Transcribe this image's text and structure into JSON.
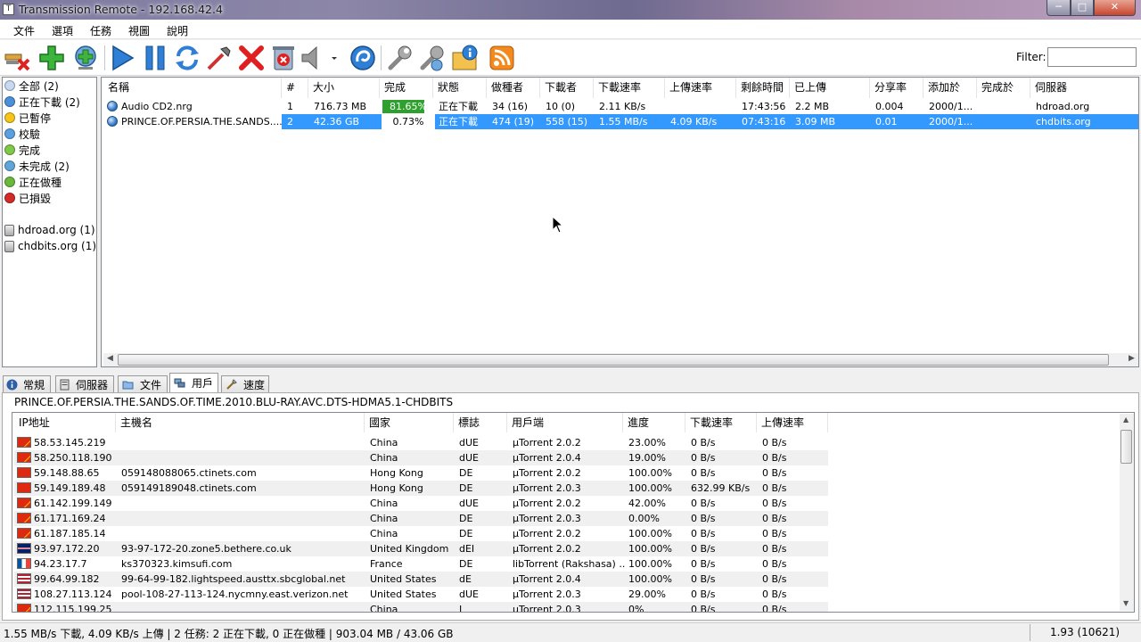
{
  "window": {
    "title": "Transmission Remote - 192.168.42.4",
    "minimize": "─",
    "maximize": "□",
    "close": "✕"
  },
  "menu": [
    "文件",
    "選項",
    "任務",
    "視圖",
    "說明"
  ],
  "toolbar": {
    "icons": [
      "disconnect-icon",
      "add-torrent-icon",
      "add-url-icon",
      "start-icon",
      "pause-icon",
      "reannounce-icon",
      "verify-icon",
      "remove-icon",
      "remove-data-icon",
      "speaker-icon",
      "web-icon",
      "options-icon",
      "connection-options-icon",
      "info-icon",
      "rss-icon"
    ],
    "filter_label": "Filter:",
    "filter_value": ""
  },
  "sidebar": {
    "items": [
      {
        "label": "全部 (2)",
        "color": "#c6d9f1"
      },
      {
        "label": "正在下載 (2)",
        "color": "#4a90d9"
      },
      {
        "label": "已暫停",
        "color": "#f5c518"
      },
      {
        "label": "校驗",
        "color": "#5aa0e0"
      },
      {
        "label": "完成",
        "color": "#7fc84a"
      },
      {
        "label": "未完成 (2)",
        "color": "#5fa6d8"
      },
      {
        "label": "正在做種",
        "color": "#6ab83a"
      },
      {
        "label": "已損毀",
        "color": "#d42a2a"
      }
    ],
    "trackers": [
      {
        "label": "hdroad.org (1)"
      },
      {
        "label": "chdbits.org (1)"
      }
    ]
  },
  "torrent_columns": [
    "名稱",
    "#",
    "大小",
    "完成",
    "狀態",
    "做種者",
    "下載者",
    "下載速率",
    "上傳速率",
    "剩餘時間",
    "已上傳",
    "分享率",
    "添加於",
    "完成於",
    "伺服器"
  ],
  "torrents": [
    {
      "name": "Audio CD2.nrg",
      "num": "1",
      "size": "716.73 MB",
      "done": "81.65%",
      "progress": 0.8165,
      "status": "正在下載",
      "seeds": "34 (16)",
      "peers": "10 (0)",
      "down": "2.11 KB/s",
      "up": "",
      "eta": "17:43:56",
      "uploaded": "2.2 MB",
      "ratio": "0.004",
      "added": "2000/1...",
      "completed": "",
      "tracker": "hdroad.org"
    },
    {
      "name": "PRINCE.OF.PERSIA.THE.SANDS....",
      "num": "2",
      "size": "42.36 GB",
      "done": "0.73%",
      "progress": 0.0073,
      "status": "正在下載",
      "seeds": "474 (19)",
      "peers": "558 (15)",
      "down": "1.55 MB/s",
      "up": "4.09 KB/s",
      "eta": "07:43:16",
      "uploaded": "3.09 MB",
      "ratio": "0.01",
      "added": "2000/1...",
      "completed": "",
      "tracker": "chdbits.org"
    }
  ],
  "tabs": [
    {
      "label": "常規",
      "icon": "info-icon"
    },
    {
      "label": "伺服器",
      "icon": "tracker-icon"
    },
    {
      "label": "文件",
      "icon": "folder-icon"
    },
    {
      "label": "用戶",
      "icon": "users-icon"
    },
    {
      "label": "速度",
      "icon": "speed-icon"
    }
  ],
  "peer_panel": {
    "title": "PRINCE.OF.PERSIA.THE.SANDS.OF.TIME.2010.BLU-RAY.AVC.DTS-HDMA5.1-CHDBITS",
    "columns": [
      "IP地址",
      "主機名",
      "國家",
      "標誌",
      "用戶端",
      "進度",
      "下載速率",
      "上傳速率"
    ],
    "peers": [
      {
        "ip": "58.53.145.219",
        "host": "",
        "country": "China",
        "flags": "dUE",
        "client": "µTorrent 2.0.2",
        "progress": "23.00%",
        "down": "0 B/s",
        "up": "0 B/s",
        "flag": "cn"
      },
      {
        "ip": "58.250.118.190",
        "host": "",
        "country": "China",
        "flags": "dUE",
        "client": "µTorrent 2.0.4",
        "progress": "19.00%",
        "down": "0 B/s",
        "up": "0 B/s",
        "flag": "cn"
      },
      {
        "ip": "59.148.88.65",
        "host": "059148088065.ctinets.com",
        "country": "Hong Kong",
        "flags": "DE",
        "client": "µTorrent 2.0.2",
        "progress": "100.00%",
        "down": "0 B/s",
        "up": "0 B/s",
        "flag": "hk"
      },
      {
        "ip": "59.149.189.48",
        "host": "059149189048.ctinets.com",
        "country": "Hong Kong",
        "flags": "DE",
        "client": "µTorrent 2.0.3",
        "progress": "100.00%",
        "down": "632.99 KB/s",
        "up": "0 B/s",
        "flag": "hk"
      },
      {
        "ip": "61.142.199.149",
        "host": "",
        "country": "China",
        "flags": "dUE",
        "client": "µTorrent 2.0.2",
        "progress": "42.00%",
        "down": "0 B/s",
        "up": "0 B/s",
        "flag": "cn"
      },
      {
        "ip": "61.171.169.24",
        "host": "",
        "country": "China",
        "flags": "DE",
        "client": "µTorrent 2.0.3",
        "progress": "0.00%",
        "down": "0 B/s",
        "up": "0 B/s",
        "flag": "cn"
      },
      {
        "ip": "61.187.185.14",
        "host": "",
        "country": "China",
        "flags": "DE",
        "client": "µTorrent 2.0.2",
        "progress": "100.00%",
        "down": "0 B/s",
        "up": "0 B/s",
        "flag": "cn"
      },
      {
        "ip": "93.97.172.20",
        "host": "93-97-172-20.zone5.bethere.co.uk",
        "country": "United Kingdom",
        "flags": "dEI",
        "client": "µTorrent 2.0.2",
        "progress": "100.00%",
        "down": "0 B/s",
        "up": "0 B/s",
        "flag": "gb"
      },
      {
        "ip": "94.23.17.7",
        "host": "ks370323.kimsufi.com",
        "country": "France",
        "flags": "DE",
        "client": "libTorrent (Rakshasa) ...",
        "progress": "100.00%",
        "down": "0 B/s",
        "up": "0 B/s",
        "flag": "fr"
      },
      {
        "ip": "99.64.99.182",
        "host": "99-64-99-182.lightspeed.austtx.sbcglobal.net",
        "country": "United States",
        "flags": "dE",
        "client": "µTorrent 2.0.4",
        "progress": "100.00%",
        "down": "0 B/s",
        "up": "0 B/s",
        "flag": "us"
      },
      {
        "ip": "108.27.113.124",
        "host": "pool-108-27-113-124.nycmny.east.verizon.net",
        "country": "United States",
        "flags": "dUE",
        "client": "µTorrent 2.0.3",
        "progress": "29.00%",
        "down": "0 B/s",
        "up": "0 B/s",
        "flag": "us"
      },
      {
        "ip": "112.115.199.25",
        "host": "",
        "country": "China",
        "flags": "I",
        "client": "µTorrent 2.0.3",
        "progress": "0%",
        "down": "0 B/s",
        "up": "0 B/s",
        "flag": "cn"
      }
    ]
  },
  "status": {
    "main": "1.55 MB/s 下載, 4.09 KB/s 上傳 | 2 任務: 2 正在下載, 0 正在做種 | 903.04 MB / 43.06 GB",
    "right": "1.93 (10621)"
  }
}
